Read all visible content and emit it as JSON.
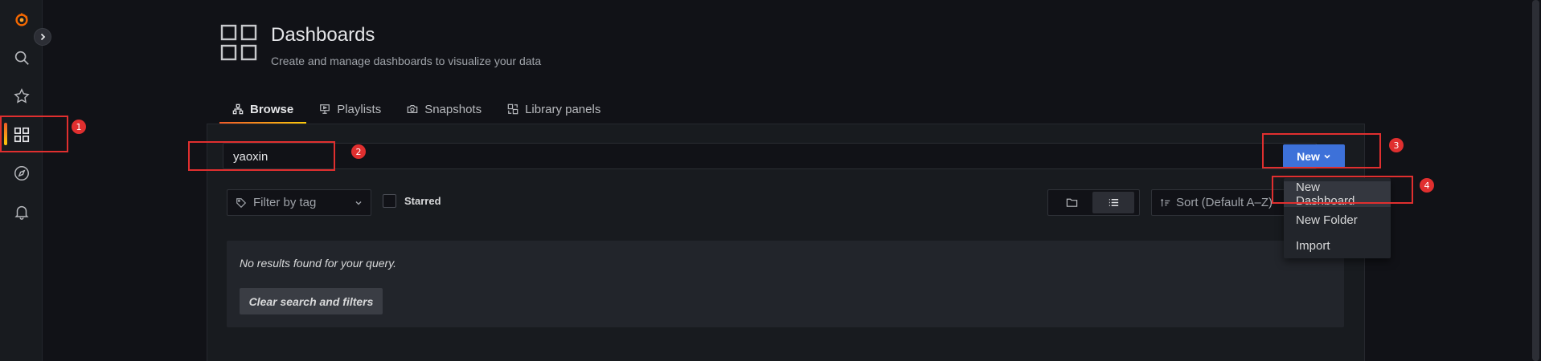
{
  "header": {
    "title": "Dashboards",
    "subtitle": "Create and manage dashboards to visualize your data"
  },
  "sidebar": {
    "items": [
      {
        "name": "grafana-logo-icon"
      },
      {
        "name": "search-icon"
      },
      {
        "name": "star-icon"
      },
      {
        "name": "dashboards-icon",
        "active": true
      },
      {
        "name": "explore-compass-icon"
      },
      {
        "name": "alerting-bell-icon"
      }
    ]
  },
  "tabs": [
    {
      "label": "Browse",
      "icon": "sitemap-icon",
      "active": true
    },
    {
      "label": "Playlists",
      "icon": "presentation-icon"
    },
    {
      "label": "Snapshots",
      "icon": "camera-icon"
    },
    {
      "label": "Library panels",
      "icon": "library-panels-icon"
    }
  ],
  "search": {
    "value": "yaoxin"
  },
  "new_button": {
    "label": "New"
  },
  "new_menu": {
    "items": [
      "New Dashboard",
      "New Folder",
      "Import"
    ]
  },
  "filters": {
    "tag_placeholder": "Filter by tag",
    "starred_label": "Starred",
    "sort_label": "Sort (Default A–Z)"
  },
  "results": {
    "empty_text": "No results found for your query.",
    "clear_label": "Clear search and filters"
  },
  "annotations": {
    "labels": [
      "1",
      "2",
      "3",
      "4"
    ],
    "color": "#e02f2f"
  },
  "colors": {
    "background": "#111217",
    "panel": "#181b1f",
    "primary": "#3d71d9",
    "accent_gradient_start": "#f05a28",
    "accent_gradient_end": "#fbca0a"
  }
}
